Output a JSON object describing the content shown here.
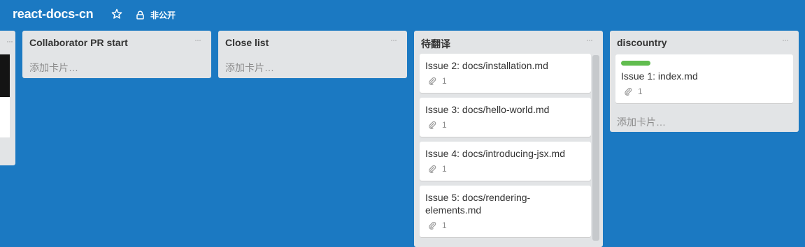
{
  "board": {
    "title": "react-docs-cn",
    "visibility": "非公开",
    "icons": {
      "star": "star-icon",
      "lock": "lock-icon"
    }
  },
  "lists": [
    {
      "title": "Collaborator PR start",
      "add_card": "添加卡片…"
    },
    {
      "title": "Close list",
      "add_card": "添加卡片…"
    },
    {
      "title": "待翻译",
      "cards": [
        {
          "title": "Issue 2: docs/installation.md",
          "attachments": "1"
        },
        {
          "title": "Issue 3: docs/hello-world.md",
          "attachments": "1"
        },
        {
          "title": "Issue 4: docs/introducing-jsx.md",
          "attachments": "1"
        },
        {
          "title": "Issue 5: docs/rendering-\nelements.md",
          "attachments": "1"
        }
      ]
    },
    {
      "title": "discountry",
      "cards": [
        {
          "title": "Issue 1: index.md",
          "attachments": "1",
          "label_color": "#61bd4f"
        }
      ],
      "add_card": "添加卡片…"
    }
  ],
  "list_menu_glyph": "···",
  "colors": {
    "board_bg": "#1b79c2",
    "list_bg": "#e2e4e6",
    "label_green": "#61bd4f"
  }
}
